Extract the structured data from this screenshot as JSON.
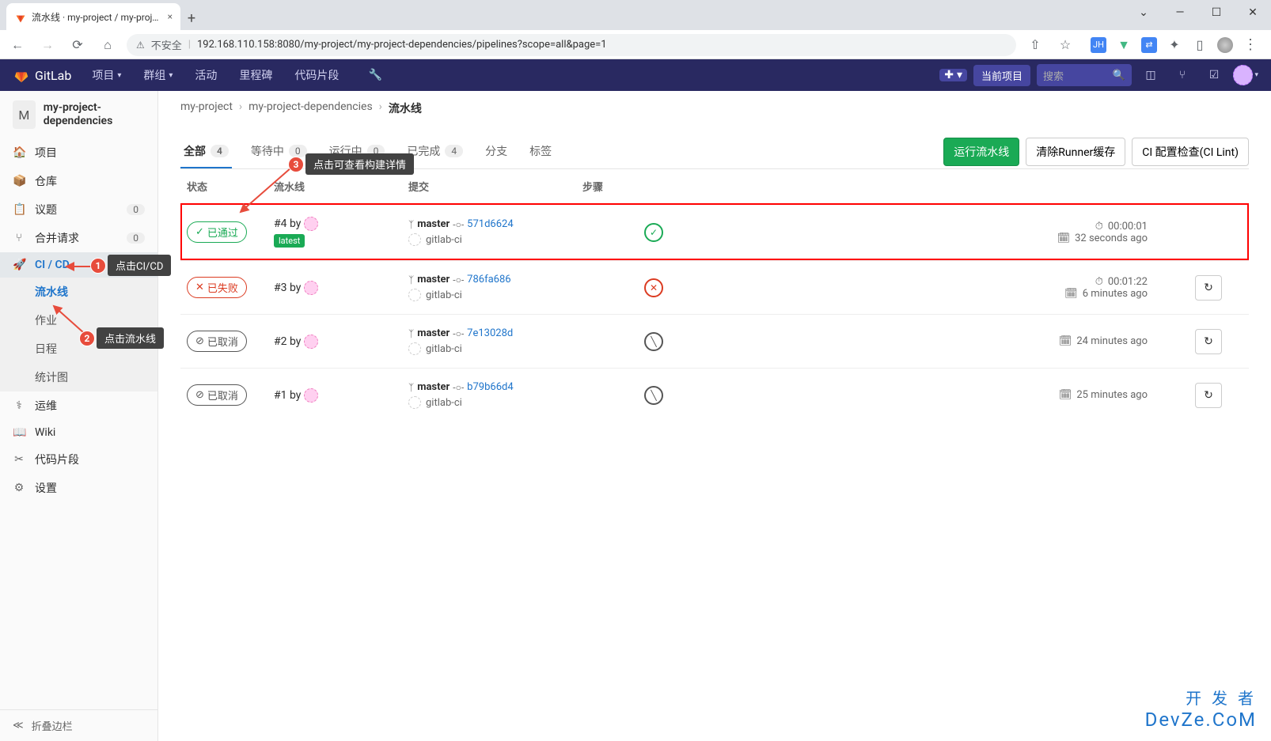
{
  "browser": {
    "tab_title": "流水线 · my-project / my-proje...",
    "url": "192.168.110.158:8080/my-project/my-project-dependencies/pipelines?scope=all&page=1",
    "insecure_label": "不安全"
  },
  "gitlab_nav": {
    "brand": "GitLab",
    "items": [
      "项目",
      "群组",
      "活动",
      "里程碑",
      "代码片段"
    ],
    "current_project": "当前项目",
    "search_placeholder": "搜索"
  },
  "project": {
    "avatar_letter": "M",
    "name": "my-project-dependencies"
  },
  "sidebar": {
    "items": [
      {
        "icon": "🏠",
        "label": "项目"
      },
      {
        "icon": "📦",
        "label": "仓库"
      },
      {
        "icon": "📋",
        "label": "议题",
        "badge": "0"
      },
      {
        "icon": "⑂",
        "label": "合并请求",
        "badge": "0"
      },
      {
        "icon": "🚀",
        "label": "CI / CD",
        "active": true
      },
      {
        "icon": "⚕",
        "label": "运维"
      },
      {
        "icon": "📖",
        "label": "Wiki"
      },
      {
        "icon": "✂",
        "label": "代码片段"
      },
      {
        "icon": "⚙",
        "label": "设置"
      }
    ],
    "sub_items": [
      "流水线",
      "作业",
      "日程",
      "统计图"
    ],
    "collapse": "折叠边栏"
  },
  "breadcrumb": [
    "my-project",
    "my-project-dependencies",
    "流水线"
  ],
  "tabs": [
    {
      "label": "全部",
      "count": "4",
      "active": true
    },
    {
      "label": "等待中",
      "count": "0"
    },
    {
      "label": "运行中",
      "count": "0"
    },
    {
      "label": "已完成",
      "count": "4"
    },
    {
      "label": "分支"
    },
    {
      "label": "标签"
    }
  ],
  "actions": {
    "run": "运行流水线",
    "clear_cache": "清除Runner缓存",
    "ci_lint": "CI 配置检查(CI Lint)"
  },
  "columns": {
    "status": "状态",
    "pipeline": "流水线",
    "commit": "提交",
    "stages": "步骤"
  },
  "pipelines": [
    {
      "status": "passed",
      "status_label": "已通过",
      "id": "#4 by",
      "latest": "latest",
      "branch": "master",
      "sha": "571d6624",
      "author": "gitlab-ci",
      "duration": "00:00:01",
      "ago": "32 seconds ago",
      "highlight": true
    },
    {
      "status": "failed",
      "status_label": "已失败",
      "id": "#3 by",
      "branch": "master",
      "sha": "786fa686",
      "author": "gitlab-ci",
      "duration": "00:01:22",
      "ago": "6 minutes ago",
      "retry": true
    },
    {
      "status": "cancelled",
      "status_label": "已取消",
      "id": "#2 by",
      "branch": "master",
      "sha": "7e13028d",
      "author": "gitlab-ci",
      "ago": "24 minutes ago",
      "retry": true
    },
    {
      "status": "cancelled",
      "status_label": "已取消",
      "id": "#1 by",
      "branch": "master",
      "sha": "b79b66d4",
      "author": "gitlab-ci",
      "ago": "25 minutes ago",
      "retry": true
    }
  ],
  "annotations": {
    "a1": "点击CI/CD",
    "a2": "点击流水线",
    "a3": "点击可查看构建详情"
  },
  "watermark": {
    "top": "开 发 者",
    "bottom": "DevZe.CoM"
  }
}
